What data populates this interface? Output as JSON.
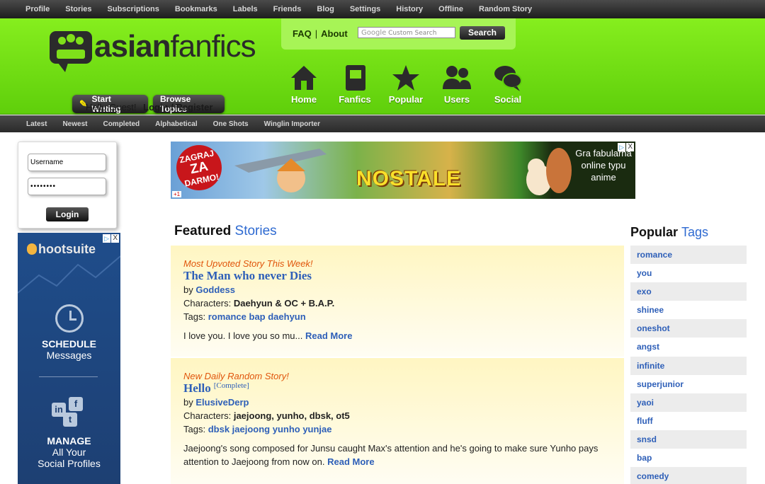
{
  "topnav": [
    "Profile",
    "Stories",
    "Subscriptions",
    "Bookmarks",
    "Labels",
    "Friends",
    "Blog",
    "Settings",
    "History",
    "Offline",
    "Random Story"
  ],
  "logo": {
    "bold": "asian",
    "light": "fanfics"
  },
  "header_buttons": {
    "start_writing": "Start Writing",
    "browse_topics": "Browse Topics"
  },
  "greeting": {
    "text": "Hello Guest!",
    "login_link": "Login / Register"
  },
  "search": {
    "faq": "FAQ",
    "separator": "|",
    "about": "About",
    "google_label": "Google",
    "placeholder": "Custom Search",
    "button": "Search"
  },
  "main_nav": [
    {
      "label": "Home",
      "icon": "house-icon"
    },
    {
      "label": "Fanfics",
      "icon": "book-icon"
    },
    {
      "label": "Popular",
      "icon": "star-icon"
    },
    {
      "label": "Users",
      "icon": "users-icon"
    },
    {
      "label": "Social",
      "icon": "chat-bubbles-icon"
    }
  ],
  "subnav": [
    "Latest",
    "Newest",
    "Completed",
    "Alphabetical",
    "One Shots",
    "Winglin Importer"
  ],
  "login": {
    "username_value": "Username",
    "password_value": "••••••••",
    "button": "Login"
  },
  "side_ad": {
    "brand": "hootsuite",
    "line1": "SCHEDULE",
    "line2": "Messages",
    "line3": "MANAGE",
    "line4": "All Your",
    "line5": "Social Profiles",
    "close": "X",
    "info": "▷"
  },
  "banner_ad": {
    "badge_top": "ZAGRAJ",
    "badge_big": "ZA",
    "badge_bottom": "DARMO!",
    "game": "NOSTALE",
    "tagline": "Gra fabularna online typu anime",
    "gplus": "+1"
  },
  "featured": {
    "title_bold": "Featured",
    "title_light": "Stories",
    "stories": [
      {
        "kind": "Most Upvoted Story This Week!",
        "title": "The Man who never Dies",
        "status": "",
        "by_label": "by",
        "author": "Goddess",
        "characters_label": "Characters:",
        "characters": "Daehyun & OC + B.A.P.",
        "tags_label": "Tags:",
        "tags": "romance bap daehyun",
        "description": "I love you. I love you so mu...",
        "read_more": "Read More"
      },
      {
        "kind": "New Daily Random Story!",
        "title": "Hello",
        "status": "[Complete]",
        "by_label": "by",
        "author": "ElusiveDerp",
        "characters_label": "Characters:",
        "characters": "jaejoong, yunho, dbsk, ot5",
        "tags_label": "Tags:",
        "tags": "dbsk jaejoong yunho yunjae",
        "description": "Jaejoong's song composed for Junsu caught Max's attention and he's going to make sure Yunho pays attention to Jaejoong from now on.",
        "read_more": "Read More"
      }
    ]
  },
  "popular_tags": {
    "title_bold": "Popular",
    "title_light": "Tags",
    "tags": [
      "romance",
      "you",
      "exo",
      "shinee",
      "oneshot",
      "angst",
      "infinite",
      "superjunior",
      "yaoi",
      "fluff",
      "snsd",
      "bap",
      "comedy"
    ]
  }
}
